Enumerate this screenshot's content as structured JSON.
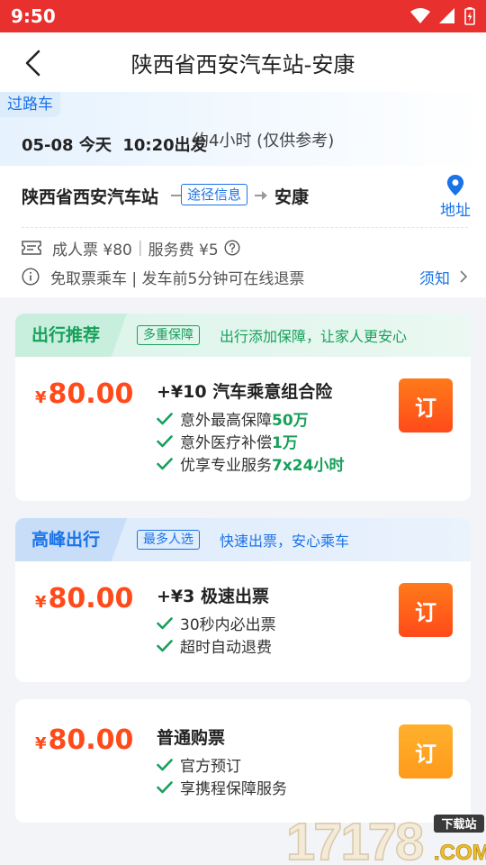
{
  "status_bar": {
    "time": "9:50"
  },
  "header": {
    "title": "陕西省西安汽车站-安康"
  },
  "trip": {
    "tag": "过路车",
    "date": "05-08 今天  10:20出发",
    "duration": "约4小时 (仅供参考)",
    "from": "陕西省西安汽车站",
    "route_tag": "途径信息",
    "to": "安康",
    "address_label": "地址",
    "adult_ticket": "成人票 ¥80",
    "service_fee": "服务费 ¥5",
    "notice": "免取票乘车 | 发车前5分钟可在线退票",
    "notice_link": "须知"
  },
  "plans": [
    {
      "head_tab": "出行推荐",
      "head_badge": "多重保障",
      "head_text": "出行添加保障，让家人更安心",
      "currency": "¥",
      "price": "80.00",
      "title": "+¥10 汽车乘意组合险",
      "features": [
        {
          "text": "意外最高保障",
          "highlight": "50万"
        },
        {
          "text": "意外医疗补偿",
          "highlight": "1万"
        },
        {
          "text": "优享专业服务",
          "highlight": "7x24小时"
        }
      ],
      "button": "订"
    },
    {
      "head_tab": "高峰出行",
      "head_badge": "最多人选",
      "head_text": "快速出票，安心乘车",
      "currency": "¥",
      "price": "80.00",
      "title": "+¥3 极速出票",
      "features": [
        {
          "text": "30秒内必出票"
        },
        {
          "text": "超时自动退费"
        }
      ],
      "button": "订"
    },
    {
      "currency": "¥",
      "price": "80.00",
      "title": "普通购票",
      "features": [
        {
          "text": "官方预订"
        },
        {
          "text": "享携程保障服务"
        }
      ],
      "button": "订"
    }
  ],
  "watermark": {
    "number": "17178",
    "tag": "下载站",
    "suffix": ".COM"
  },
  "colors": {
    "status_bar": "#e8302e",
    "accent_blue": "#1a73e8",
    "accent_green": "#17a05a",
    "price": "#ff4a1a"
  }
}
